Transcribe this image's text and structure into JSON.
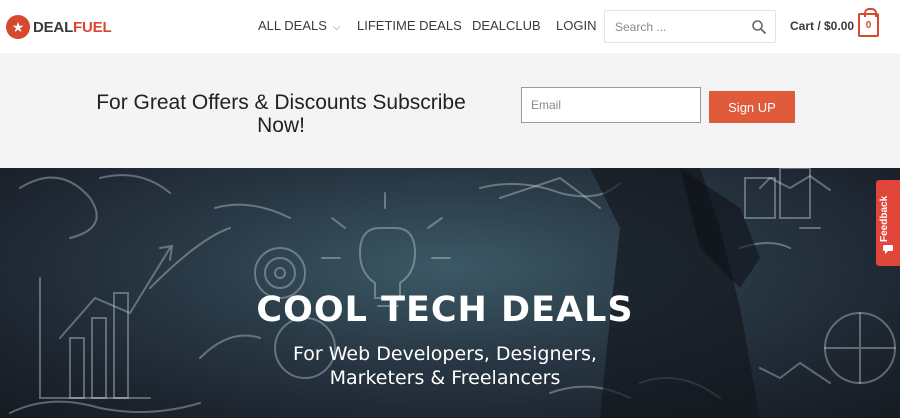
{
  "brand": {
    "name_part1": "DEAL",
    "name_part2": "FUEL",
    "accent": "#d6492f"
  },
  "nav": {
    "items": [
      {
        "label": "ALL DEALS",
        "has_dropdown": true
      },
      {
        "label": "LIFETIME DEALS"
      },
      {
        "label": "DEALCLUB"
      },
      {
        "label": "LOGIN"
      }
    ],
    "dropdown_icon": "chevron-down-icon"
  },
  "search": {
    "placeholder": "Search ...",
    "icon": "search-icon"
  },
  "cart": {
    "label": "Cart / $0.00",
    "count": "0",
    "icon": "shopping-bag-icon"
  },
  "subscribe": {
    "heading": "For Great Offers & Discounts Subscribe Now!",
    "email_placeholder": "Email",
    "button_label": "Sign UP",
    "button_color": "#e05a3c"
  },
  "hero": {
    "title": "COOL TECH DEALS",
    "subtitle_line1": "For Web Developers, Designers,",
    "subtitle_line2": "Marketers & Freelancers"
  },
  "feedback": {
    "label": "Feedback",
    "icon": "chat-icon",
    "color": "#e0463a"
  }
}
